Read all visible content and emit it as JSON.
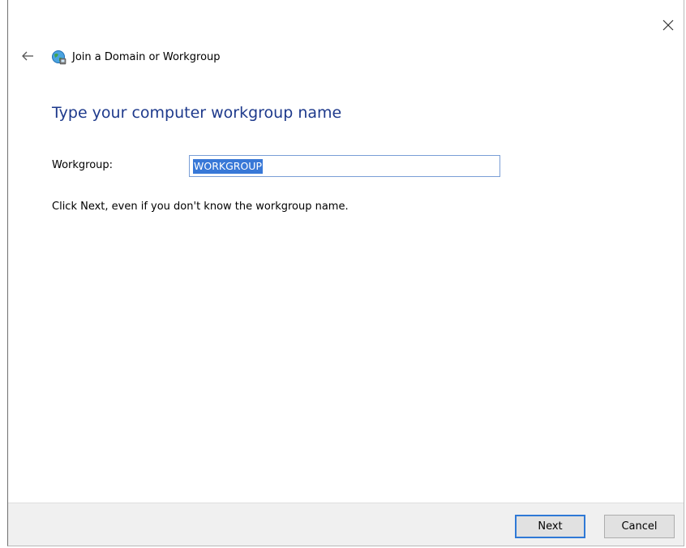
{
  "window": {
    "title": "Join a Domain or Workgroup",
    "close_icon": "close-icon",
    "back_icon": "back-arrow-icon",
    "app_icon": "network-globe-icon"
  },
  "content": {
    "heading": "Type your computer workgroup name",
    "workgroup_label": "Workgroup:",
    "workgroup_value": "WORKGROUP",
    "hint": "Click Next, even if you don't know the workgroup name."
  },
  "footer": {
    "next_label": "Next",
    "cancel_label": "Cancel"
  },
  "colors": {
    "heading": "#1e3a8c",
    "selection": "#3878d7",
    "focus_border": "#2f79d6",
    "footer_bg": "#f0f0f0"
  }
}
